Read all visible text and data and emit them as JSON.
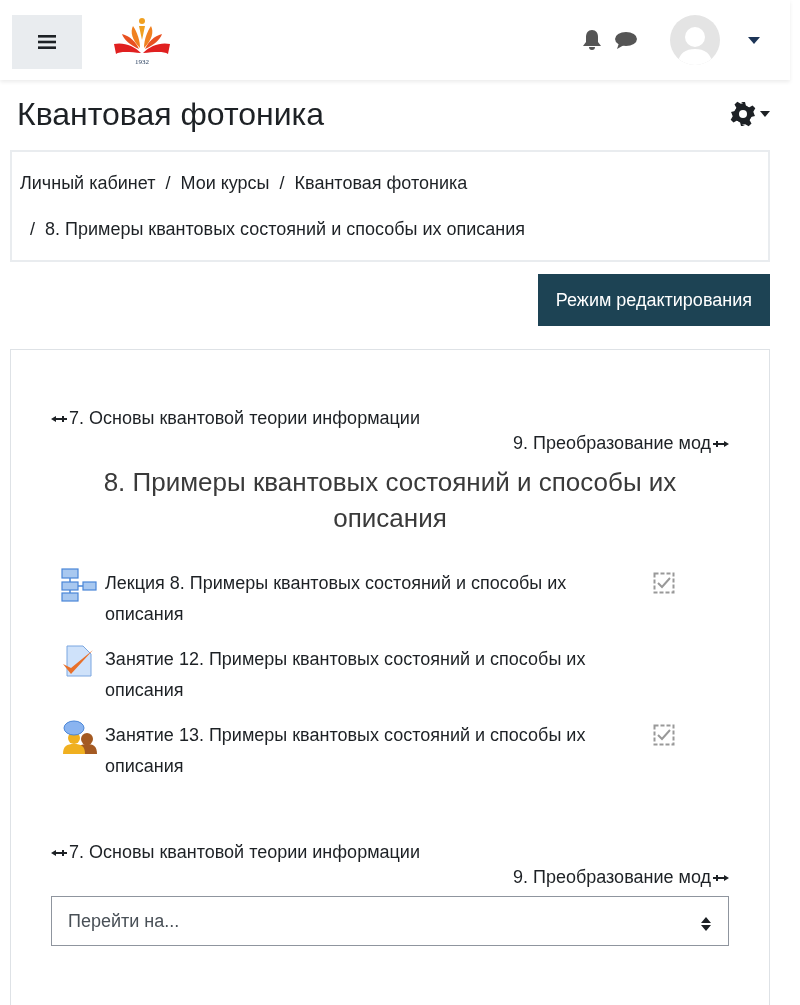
{
  "header": {
    "logo_caption": "1932"
  },
  "page_title": "Квантовая фотоника",
  "breadcrumb": [
    {
      "label": "Личный кабинет"
    },
    {
      "separator": "/",
      "label": "Мои курсы"
    },
    {
      "separator": "/",
      "label": "Квантовая фотоника"
    },
    {
      "separator": "/",
      "label": "8. Примеры квантовых состояний и способы их описания"
    }
  ],
  "edit_button": "Режим редактирования",
  "section_nav_top": {
    "previous": "7. Основы квантовой теории информации",
    "next": "9. Преобразование мод"
  },
  "section_title": "8. Примеры квантовых состояний и способы их описания",
  "activities": [
    {
      "kind": "lesson",
      "title": "Лекция 8. Примеры квантовых состояний и способы их описания",
      "completion_box": true
    },
    {
      "kind": "assignment",
      "title": "Занятие 12. Примеры квантовых состояний и способы их описания",
      "completion_box": false
    },
    {
      "kind": "chat",
      "title": "Занятие 13. Примеры квантовых состояний и способы их описания",
      "completion_box": true
    }
  ],
  "section_nav_bottom": {
    "previous": "7. Основы квантовой теории информации",
    "next": "9. Преобразование мод"
  },
  "jump_select": {
    "placeholder": "Перейти на..."
  }
}
